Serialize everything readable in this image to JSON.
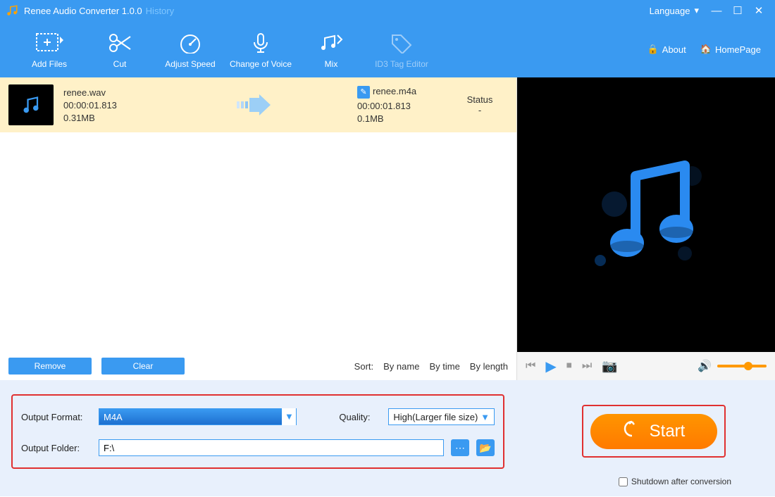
{
  "title": {
    "app": "Renee Audio Converter 1.0.0",
    "history": "History",
    "language": "Language"
  },
  "toolbar": {
    "add_files": "Add Files",
    "cut": "Cut",
    "adjust_speed": "Adjust Speed",
    "change_voice": "Change of Voice",
    "mix": "Mix",
    "id3": "ID3 Tag Editor",
    "about": "About",
    "homepage": "HomePage"
  },
  "file": {
    "src_name": "renee.wav",
    "src_dur": "00:00:01.813",
    "src_size": "0.31MB",
    "dst_name": "renee.m4a",
    "dst_dur": "00:00:01.813",
    "dst_size": "0.1MB",
    "status_label": "Status",
    "status_val": "-"
  },
  "list_footer": {
    "remove": "Remove",
    "clear": "Clear",
    "sort_label": "Sort:",
    "by_name": "By name",
    "by_time": "By time",
    "by_length": "By length"
  },
  "output": {
    "format_label": "Output Format:",
    "format_value": "M4A",
    "quality_label": "Quality:",
    "quality_value": "High(Larger file size)",
    "folder_label": "Output Folder:",
    "folder_value": "F:\\"
  },
  "start": {
    "label": "Start",
    "shutdown": "Shutdown after conversion"
  }
}
